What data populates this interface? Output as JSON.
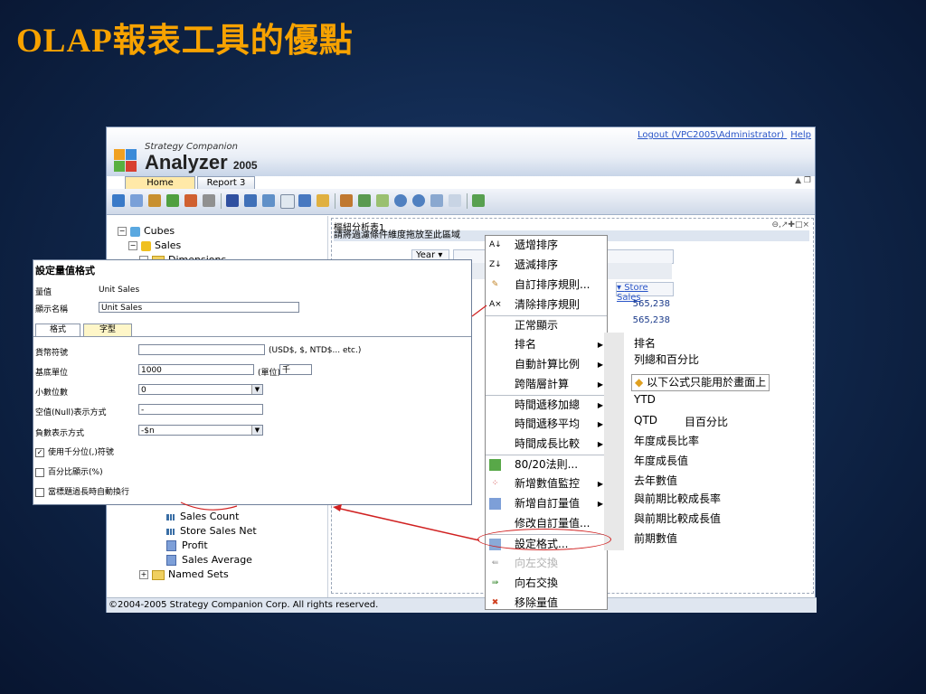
{
  "slide": {
    "title": "OLAP報表工具的優點"
  },
  "app": {
    "logo_small": "Strategy Companion",
    "logo_big": "Analyzer",
    "logo_year": "2005",
    "top_links": [
      "Logout (VPC2005\\Administrator)",
      "Help"
    ],
    "tabs": [
      "Home",
      "Report 3"
    ],
    "footer": "©2004-2005 Strategy Companion Corp. All rights reserved."
  },
  "tree": {
    "cubes": "Cubes",
    "sales": "Sales",
    "dimensions": "Dimensions",
    "measures": [
      "Sales Count",
      "Store Sales Net",
      "Profit",
      "Sales Average"
    ],
    "named_sets": "Named Sets"
  },
  "report": {
    "title": "樞紐分析表1",
    "hint": "請將過濾條件維度拖放至此區域",
    "year_header": "Year",
    "store_sales_header": "Store Sales",
    "values": [
      "565,238",
      "565,238"
    ]
  },
  "dialog": {
    "title": "設定量值格式",
    "measure_label": "量值",
    "measure_value": "Unit Sales",
    "display_label": "顯示名稱",
    "display_value": "Unit Sales",
    "tab_format": "格式",
    "tab_font": "字型",
    "currency_label": "貨幣符號",
    "currency_hint": "(USD$, $, NTD$... etc.)",
    "base_unit_label": "基底單位",
    "base_unit_value": "1000",
    "unit_label": "(單位)",
    "unit_value": "千",
    "decimal_label": "小數位數",
    "decimal_value": "0",
    "null_label": "空值(Null)表示方式",
    "null_value": "-",
    "negative_label": "負數表示方式",
    "negative_value": "-$n",
    "opt_thousands": "使用千分位(,)符號",
    "opt_thousands_checked": true,
    "opt_percent": "百分比顯示(%)",
    "opt_wrap": "當標題過長時自動換行"
  },
  "menu": {
    "items": [
      {
        "label": "遞增排序",
        "icon": "sort-asc-icon",
        "sub": false
      },
      {
        "label": "遞減排序",
        "icon": "sort-desc-icon",
        "sub": false
      },
      {
        "label": "自訂排序規則...",
        "icon": "custom-sort-icon",
        "sub": false
      },
      {
        "label": "清除排序規則",
        "icon": "clear-sort-icon",
        "sub": false
      },
      {
        "label": "正常顯示",
        "icon": "",
        "sub": false
      },
      {
        "label": "排名",
        "icon": "",
        "sub": true
      },
      {
        "label": "自動計算比例",
        "icon": "",
        "sub": true
      },
      {
        "label": "跨階層計算",
        "icon": "",
        "sub": true
      },
      {
        "label": "時間遞移加總",
        "icon": "",
        "sub": true
      },
      {
        "label": "時間遞移平均",
        "icon": "",
        "sub": true
      },
      {
        "label": "時間成長比較",
        "icon": "",
        "sub": true
      },
      {
        "label": "80/20法則...",
        "icon": "chart-icon",
        "sub": false
      },
      {
        "label": "新增數值監控",
        "icon": "monitor-icon",
        "sub": true
      },
      {
        "label": "新增自訂量值",
        "icon": "calc-icon",
        "sub": true
      },
      {
        "label": "修改自訂量值...",
        "icon": "",
        "sub": false
      },
      {
        "label": "設定格式...",
        "icon": "format-icon",
        "sub": false
      },
      {
        "label": "向左交換",
        "icon": "swap-left-icon",
        "sub": false,
        "disabled": true
      },
      {
        "label": "向右交換",
        "icon": "swap-right-icon",
        "sub": false
      },
      {
        "label": "移除量值",
        "icon": "remove-icon",
        "sub": false
      }
    ],
    "submenu": [
      "排名",
      "列總和百分比",
      "以下公式只能用於畫面上",
      "YTD",
      "QTD",
      "目百分比",
      "年度成長比率",
      "年度成長值",
      "去年數值",
      "與前期比較成長率",
      "與前期比較成長值",
      "前期數值"
    ]
  }
}
